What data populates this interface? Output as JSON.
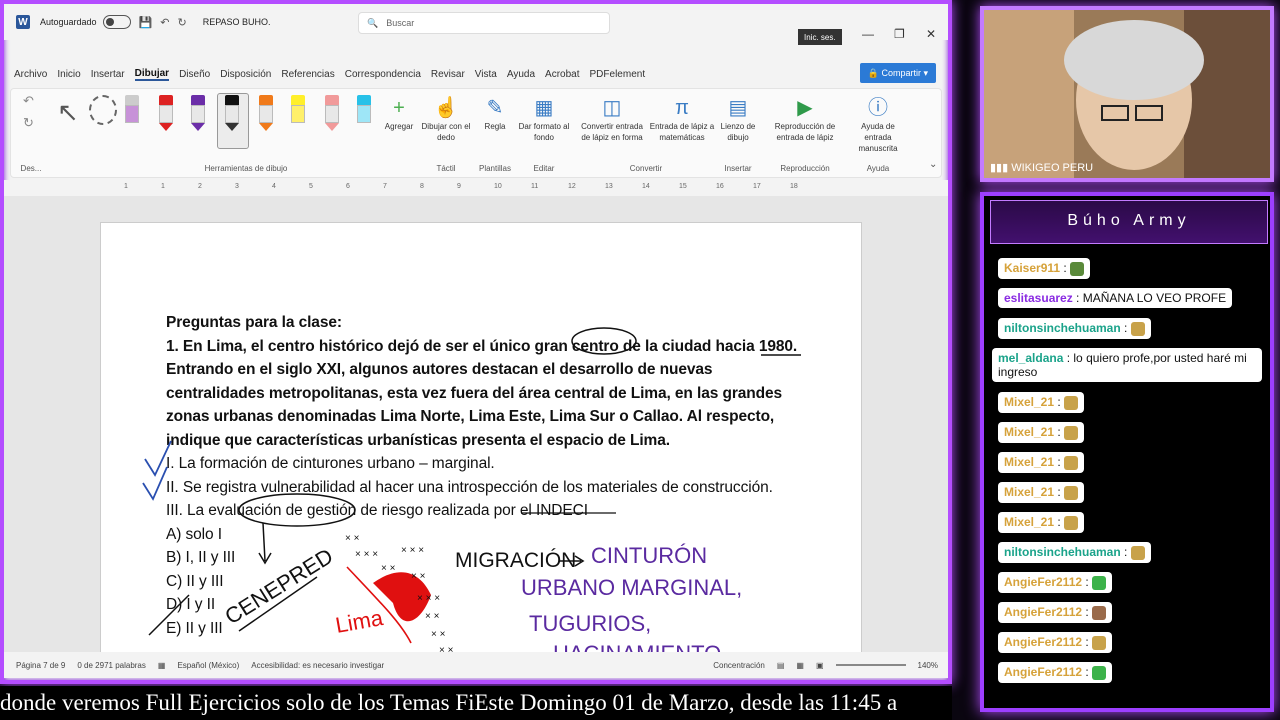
{
  "word": {
    "autosave_label": "Autoguardado",
    "doc_title": "REPASO BUHO.",
    "search_placeholder": "Buscar",
    "signin_label": "Inic. ses.",
    "share_label": "Compartir",
    "menu": [
      "Archivo",
      "Inicio",
      "Insertar",
      "Dibujar",
      "Diseño",
      "Disposición",
      "Referencias",
      "Correspondencia",
      "Revisar",
      "Vista",
      "Ayuda",
      "Acrobat",
      "PDFelement"
    ],
    "active_menu": "Dibujar",
    "ribbon": {
      "group_des": "Des...",
      "group_tools": "Herramientas de dibujo",
      "add_label": "Agregar",
      "touch_draw": "Dibujar con el dedo",
      "group_touch": "Táctil",
      "ruler": "Regla",
      "group_templates": "Plantillas",
      "format_bg": "Dar formato al fondo",
      "group_edit": "Editar",
      "ink_to_shape": "Convertir entrada de lápiz en forma",
      "ink_to_math": "Entrada de lápiz a matemáticas",
      "group_convert": "Convertir",
      "canvas": "Lienzo de dibujo",
      "group_insert": "Insertar",
      "replay": "Reproducción de entrada de lápiz",
      "group_replay": "Reproducción",
      "help_ink": "Ayuda de entrada manuscrita",
      "group_help": "Ayuda"
    },
    "ruler_marks": [
      "1",
      "1",
      "2",
      "3",
      "4",
      "5",
      "6",
      "7",
      "8",
      "9",
      "10",
      "11",
      "12",
      "13",
      "14",
      "15",
      "16",
      "17",
      "18"
    ],
    "document": {
      "heading": "Preguntas para la clase:",
      "lines": [
        "1. En Lima, el centro histórico dejó de ser el único gran centro de la ciudad hacia 1980.",
        "Entrando en el siglo XXI, algunos autores destacan el desarrollo de nuevas",
        "centralidades metropolitanas, esta vez fuera del área central de Lima, en las grandes",
        "zonas urbanas denominadas Lima Norte, Lima Este, Lima Sur o Callao. Al respecto,",
        "indique que características urbanísticas presenta el espacio de Lima."
      ],
      "options": [
        "I. La formación de cinturones urbano – marginal.",
        "II. Se registra vulnerabilidad al hacer una introspección de los materiales de construcción.",
        "III. La evaluación de gestión de riesgo realizada por el INDECI",
        "A) solo I",
        "B) I, II y III",
        "C) II y III",
        "D) I y II",
        "E) II y III"
      ],
      "handwriting": {
        "cenepred": "CENEPRED",
        "lima": "Lima",
        "migracion": "MIGRACIÓN",
        "cinturon": "CINTURÓN",
        "urbano": "URBANO MARGINAL,",
        "tugurios": "TUGURIOS,",
        "hacinamiento": "HACINAMIENTO"
      }
    },
    "status": {
      "page": "Página 7 de 9",
      "words": "0 de 2971 palabras",
      "language": "Español (México)",
      "accessibility": "Accesibilidad: es necesario investigar",
      "focus": "Concentración",
      "zoom": "140%"
    }
  },
  "ticker": "donde veremos Full Ejercicios solo de los Temas FiEste Domingo 01 de Marzo, desde las 11:45 a",
  "webcam": {
    "label": "WIKIGEO PERU"
  },
  "chat": {
    "title": "Búho Army",
    "messages": [
      {
        "user": "Kaiser911",
        "text": "",
        "color": "#d6a23a"
      },
      {
        "user": "eslitasuarez",
        "text": "MAÑANA LO VEO PROFE",
        "color": "#8a2be2"
      },
      {
        "user": "niltonsinchehuaman",
        "text": "",
        "color": "#1aa38a"
      },
      {
        "user": "mel_aldana",
        "text": "lo quiero profe,por usted haré mi ingreso",
        "color": "#1aa38a"
      },
      {
        "user": "Mixel_21",
        "text": "",
        "color": "#d6a23a"
      },
      {
        "user": "Mixel_21",
        "text": "",
        "color": "#d6a23a"
      },
      {
        "user": "Mixel_21",
        "text": "",
        "color": "#d6a23a"
      },
      {
        "user": "Mixel_21",
        "text": "",
        "color": "#d6a23a"
      },
      {
        "user": "Mixel_21",
        "text": "",
        "color": "#d6a23a"
      },
      {
        "user": "niltonsinchehuaman",
        "text": "",
        "color": "#1aa38a"
      },
      {
        "user": "AngieFer2112",
        "text": "",
        "color": "#d6a23a"
      },
      {
        "user": "AngieFer2112",
        "text": "",
        "color": "#d6a23a"
      },
      {
        "user": "AngieFer2112",
        "text": "",
        "color": "#d6a23a"
      },
      {
        "user": "AngieFer2112",
        "text": "",
        "color": "#d6a23a"
      }
    ]
  }
}
